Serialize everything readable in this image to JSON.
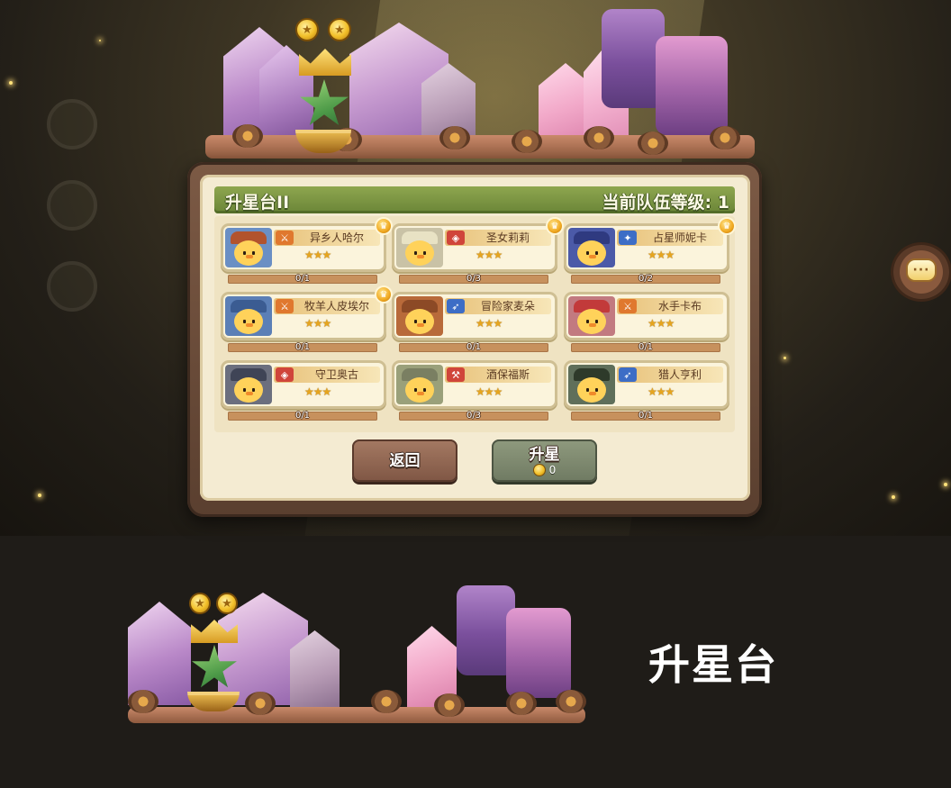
{
  "panel": {
    "title": "升星台II",
    "team_level_label": "当前队伍等级:",
    "team_level_value": "1"
  },
  "heroes": [
    {
      "name": "异乡人哈尔",
      "progress": "0/1",
      "stars": "★★★",
      "class_icon": "sword-icon",
      "has_badge": true
    },
    {
      "name": "圣女莉莉",
      "progress": "0/3",
      "stars": "★★★",
      "class_icon": "shield-icon",
      "has_badge": true
    },
    {
      "name": "占星师妮卡",
      "progress": "0/2",
      "stars": "★★★",
      "class_icon": "staff-icon",
      "has_badge": true
    },
    {
      "name": "牧羊人皮埃尔",
      "progress": "0/1",
      "stars": "★★★",
      "class_icon": "sword-icon",
      "has_badge": true
    },
    {
      "name": "冒险家麦朵",
      "progress": "0/1",
      "stars": "★★★",
      "class_icon": "bow-icon",
      "has_badge": false
    },
    {
      "name": "水手卡布",
      "progress": "0/1",
      "stars": "★★★",
      "class_icon": "sword-icon",
      "has_badge": false
    },
    {
      "name": "守卫奥古",
      "progress": "0/1",
      "stars": "★★★",
      "class_icon": "shield-icon",
      "has_badge": false
    },
    {
      "name": "酒保福斯",
      "progress": "0/3",
      "stars": "★★★",
      "class_icon": "hammer-icon",
      "has_badge": false
    },
    {
      "name": "猎人亨利",
      "progress": "0/1",
      "stars": "★★★",
      "class_icon": "bow-icon",
      "has_badge": false
    }
  ],
  "buttons": {
    "back_label": "返回",
    "upgrade_label": "升星",
    "upgrade_cost": "0"
  },
  "chat_button": {
    "icon": "chat-bubble-icon",
    "glyph": "···"
  },
  "showcase": {
    "title": "升星台"
  },
  "colors": {
    "panel_header_green": "#7a9641",
    "panel_bg": "#f4ebd2",
    "frame_brown": "#6b4c3a",
    "progress_bar": "#c7915d",
    "page_bg": "#1f1c18"
  }
}
